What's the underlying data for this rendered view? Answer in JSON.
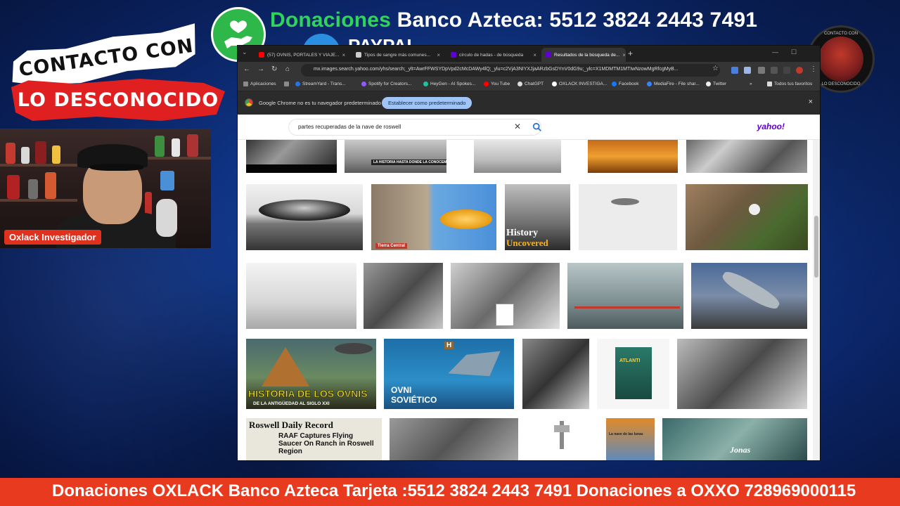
{
  "overlay": {
    "banner_green": "Donaciones",
    "banner_white": "Banco Azteca: 5512 3824 2443 7491",
    "banner_line2": "PAYPAL",
    "logo_line1": "CONTACTO CON",
    "logo_line2": "LO DESCONOCIDO",
    "name_tag": "Oxlack Investigador",
    "badge_top": "CONTACTO CON",
    "badge_bottom": "LO DESCONOCIDO",
    "ticker": "Donaciones OXLACK Banco Azteca Tarjeta :5512 3824 2443 7491 Donaciones a OXXO 728969000115"
  },
  "browser": {
    "tabs": [
      {
        "label": "(57) OVNIS, PORTALES Y VIAJE...",
        "favicon_color": "#ff0000",
        "active": false
      },
      {
        "label": "Tipos de sangre más comunes...",
        "favicon_color": "#cccccc",
        "active": false
      },
      {
        "label": "círculo de hadas - de búsqueda",
        "favicon_color": "#6001d2",
        "active": false
      },
      {
        "label": "Resultados de la búsqueda de...",
        "favicon_color": "#6001d2",
        "active": true
      }
    ],
    "url": "mx.images.search.yahoo.com/yhs/search;_ylt=AwrFFWSYDpVpd2cMcDAWy4lQ;_ylu=c2VjA3NIYXJjaARzbGsDYnV0dG9u;_ylc=X1MDMTM1MTIwNzowMgRfcgMyB...",
    "bookmarks": [
      {
        "label": "Aplicaciones",
        "color": "#8a8a8a"
      },
      {
        "label": "StreamYard - Trans...",
        "color": "#2f6fdf"
      },
      {
        "label": "Spotify for Creators...",
        "color": "#8b5cf6"
      },
      {
        "label": "HeyGen - AI Spokes...",
        "color": "#22c1a0"
      },
      {
        "label": "You Tube",
        "color": "#ff0000"
      },
      {
        "label": "ChatGPT",
        "color": "#dddddd"
      },
      {
        "label": "OXLACK INVESTIGA...",
        "color": "#ffffff"
      },
      {
        "label": "Facebook",
        "color": "#1877f2"
      },
      {
        "label": "MediaFire - File shar...",
        "color": "#3b82f6"
      },
      {
        "label": "Twitter",
        "color": "#eeeeee"
      }
    ],
    "bookmarks_all": "Todos tus favoritos",
    "infobar_text": "Google Chrome no es tu navegador predeterminado",
    "infobar_button": "Establecer como predeterminado"
  },
  "yahoo": {
    "search_query": "partes recuperadas de la nave de roswell",
    "logo": "yahoo!"
  },
  "image_labels": {
    "history_caption": "LA HISTORIA HASTA DONDE LA CONOCEMOS!",
    "history_uncovered_1": "History",
    "history_uncovered_2": "Uncovered",
    "tierra_central": "Tierra Central",
    "historia_ovnis_1": "HISTORIA DE LOS OVNIS",
    "historia_ovnis_2": "DE LA ANTIGÜEDAD AL SIGLO XXI",
    "ovni_sovietico_1": "OVNI",
    "ovni_sovietico_2": "SOVIÉTICO",
    "history_h": "H",
    "atlanti": "ATLANTI",
    "roswell_record": "Roswell Daily Record",
    "raaf_headline": "RAAF Captures Flying Saucer On Ranch in Roswell Region",
    "jonas": "Jonas",
    "libro_nave": "La nave de las lunas"
  },
  "colors": {
    "ticker_red": "#e83a1e",
    "banner_green": "#2fd45a",
    "yahoo_purple": "#6001d2"
  }
}
